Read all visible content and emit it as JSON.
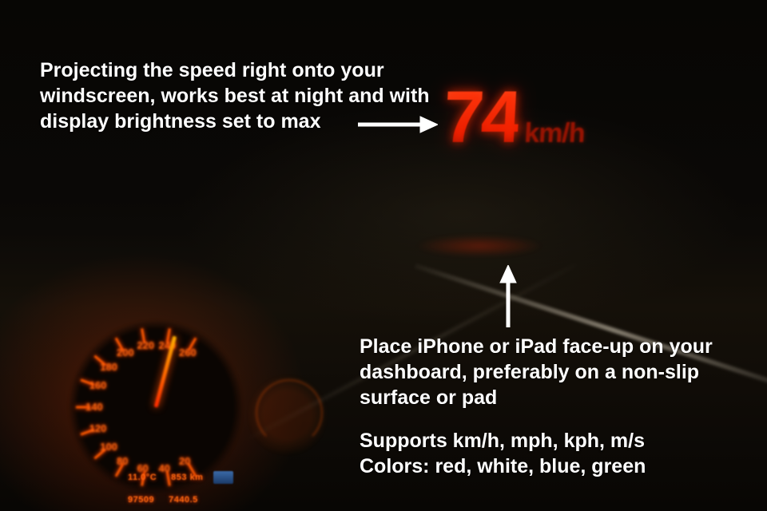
{
  "hud": {
    "speed_value": "74",
    "speed_unit": "km/h"
  },
  "captions": {
    "top": "Projecting the speed right onto your windscreen, works best at night and with display brightness set to max",
    "bottom_line1": "Place iPhone or iPad face-up on your dashboard, preferably on a non-slip surface or pad",
    "bottom_line2": "Supports km/h, mph, kph, m/s",
    "bottom_line3": "Colors: red, white, blue, green"
  },
  "gauge": {
    "numbers": [
      "20",
      "40",
      "60",
      "80",
      "100",
      "120",
      "140",
      "160",
      "180",
      "200",
      "220",
      "240",
      "260"
    ]
  },
  "cluster": {
    "temp": "11.0°C",
    "trip_km": "853 km",
    "odo": "97509",
    "odo2": "7440.5"
  }
}
